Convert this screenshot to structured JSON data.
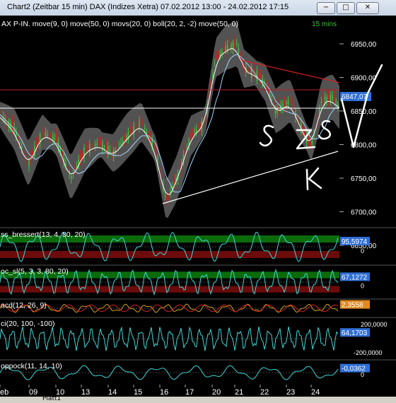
{
  "window": {
    "title": "Chart2 (Zeitbar 15 min)  DAX (Indizes Xetra) 07.02.2012 13:00 - 24.02.2012 17:15",
    "minimize_label": "−",
    "maximize_label": "□",
    "close_label": "✕"
  },
  "main_panel": {
    "legend": "AX P-IN. move(9, 0) move(50, 0) movs(20, 0) boll(20, 2, -2) move(50, 0)",
    "timeframe": "15 mins",
    "price_ticks": [
      "6950,00",
      "6900,00",
      "6850,00",
      "6800,00",
      "6750,00",
      "6700,00",
      "6650,00"
    ],
    "last_price": "6847,07",
    "annotations": [
      "S",
      "Z",
      "S",
      "K"
    ]
  },
  "indicators": [
    {
      "name": "ss_bressert(13, 4, 80, 20)",
      "value": "95,5974",
      "axis_label": "0"
    },
    {
      "name": "oc_sl(5, 3, 3, 80, 20)",
      "value": "67,1272",
      "axis_label": "0"
    },
    {
      "name": "acd(12, 26, 9)",
      "value": "2,3558",
      "axis_label": ""
    },
    {
      "name": "ci(20, 100, -100)",
      "value": "64,1703",
      "axis_label": "200,0000",
      "axis_label2": "-200,0000"
    },
    {
      "name": "oppock(11, 14, 10)",
      "value": "-0,0362",
      "axis_label": "0"
    }
  ],
  "date_axis": [
    "eb",
    "09",
    "10",
    "13",
    "14",
    "15",
    "16",
    "17",
    "20",
    "21",
    "22",
    "23",
    "24"
  ],
  "tab": {
    "label": "Platt1"
  },
  "colors": {
    "background": "#000000",
    "candle_up": "#3fbf3f",
    "candle_down": "#d02020",
    "bollinger_band": "#6e6e6e",
    "moving_average": "#ffffff",
    "oscillator": "#3fd7d7",
    "overbought_zone": "#0b6b0b",
    "oversold_zone": "#6b0b0b",
    "trendline_upper": "#d02020",
    "trendline_lower": "#ffffff",
    "value_box": "#2f6fd6",
    "macd_value_box": "#e08a1e"
  }
}
